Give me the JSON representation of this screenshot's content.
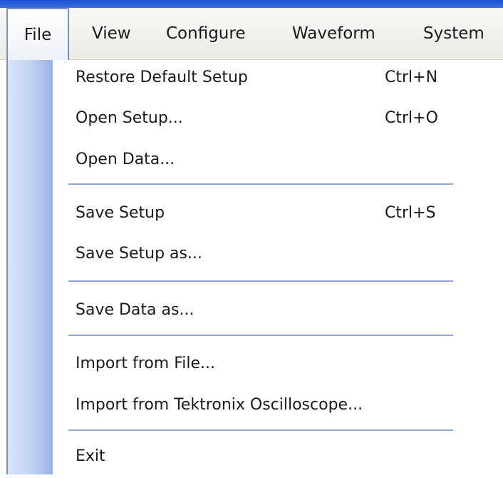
{
  "menubar": {
    "items": [
      {
        "label": "File"
      },
      {
        "label": "View"
      },
      {
        "label": "Configure"
      },
      {
        "label": "Waveform"
      },
      {
        "label": "System"
      }
    ],
    "active": "File"
  },
  "file_menu": {
    "items": [
      {
        "label": "Restore Default Setup",
        "shortcut": "Ctrl+N"
      },
      {
        "label": "Open Setup...",
        "shortcut": "Ctrl+O"
      },
      {
        "label": "Open Data...",
        "shortcut": ""
      },
      {
        "label": "Save Setup",
        "shortcut": "Ctrl+S"
      },
      {
        "label": "Save Setup as...",
        "shortcut": ""
      },
      {
        "label": "Save Data as...",
        "shortcut": ""
      },
      {
        "label": "Import from File...",
        "shortcut": ""
      },
      {
        "label": "Import from Tektronix Oscilloscope...",
        "shortcut": ""
      },
      {
        "label": "Exit",
        "shortcut": ""
      }
    ]
  },
  "colors": {
    "title_strip": "#1f52cf",
    "gutter": "#c3d3f1",
    "separator": "#8ea6dc",
    "active_border": "#7b93c8"
  }
}
